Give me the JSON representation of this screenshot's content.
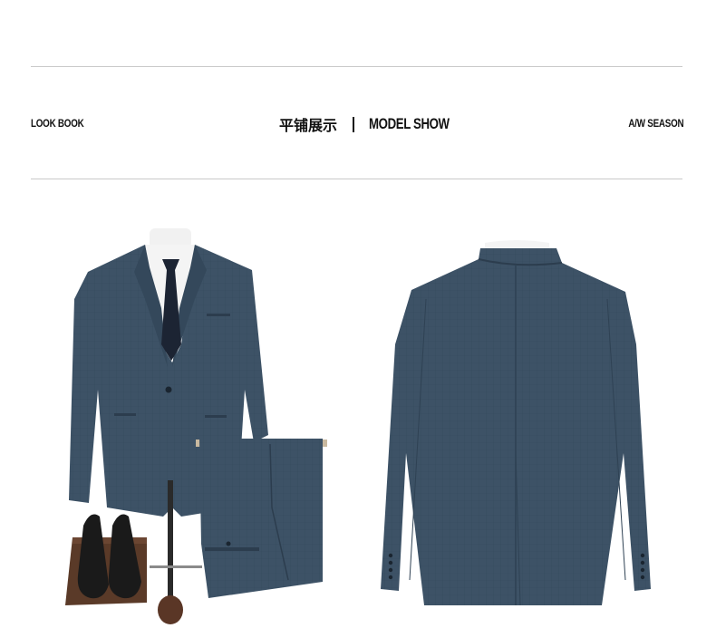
{
  "header": {
    "left_label": "LOOK BOOK",
    "center_zh": "平铺展示",
    "center_en": "MODEL SHOW",
    "right_label": "A/W SEASON"
  },
  "colors": {
    "suit": "#3d5266",
    "suit_dark": "#2c3d4e",
    "tie": "#1c2433",
    "shoe": "#1a1a1a",
    "box": "#5a3a28",
    "rule": "#c9c9c9"
  },
  "images": {
    "front_set": "front suit jacket with trousers, mannequin stand and leather shoes",
    "back_view": "back of suit jacket"
  }
}
